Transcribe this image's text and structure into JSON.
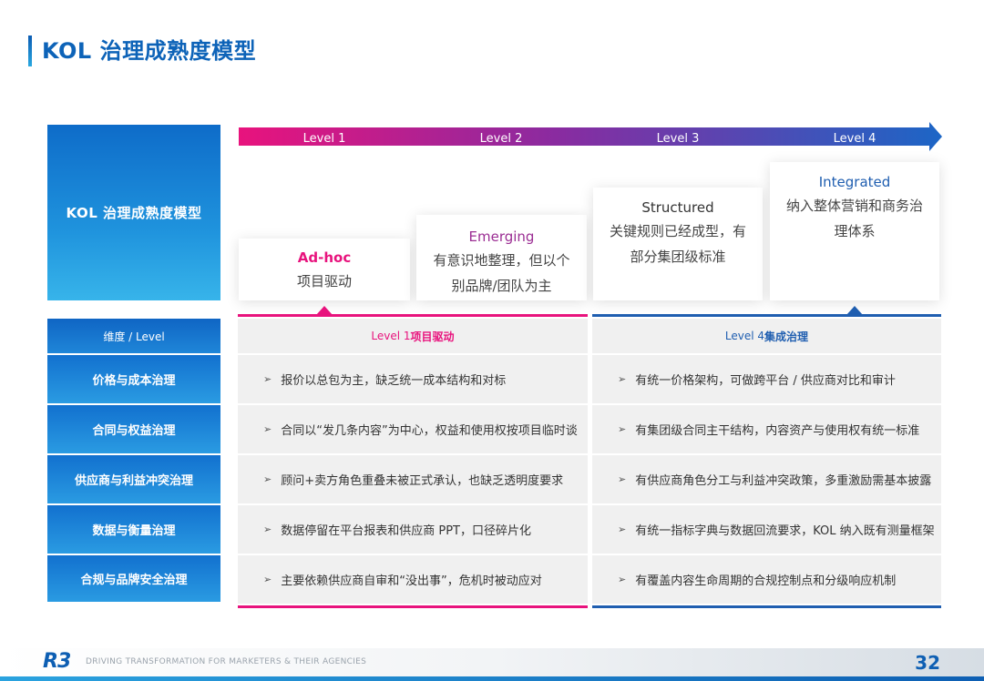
{
  "page": {
    "title": "KOL 治理成熟度模型",
    "page_number": "32",
    "footer_logo": "R3",
    "footer_tagline": "DRIVING TRANSFORMATION FOR MARKETERS & THEIR AGENCIES"
  },
  "model_label": "KOL 治理成熟度模型",
  "levels": [
    "Level 1",
    "Level 2",
    "Level 3",
    "Level 4"
  ],
  "cards": [
    {
      "name": "Ad-hoc",
      "desc": [
        "项目驱动"
      ]
    },
    {
      "name": "Emerging",
      "desc": [
        "有意识地整理，但以个",
        "别品牌/团队为主"
      ]
    },
    {
      "name": "Structured",
      "desc": [
        "关键规则已经成型，有",
        "部分集团级标准"
      ]
    },
    {
      "name": "Integrated",
      "desc": [
        "纳入整体营销和商务治",
        "理体系"
      ]
    }
  ],
  "table": {
    "dimension_header": "维度 / Level",
    "col1_header_prefix": "Level 1 ",
    "col1_header_bold": "项目驱动",
    "col2_header_prefix": "Level 4 ",
    "col2_header_bold": "集成治理",
    "bullet_symbol": "➢",
    "rows": [
      {
        "dimension": "价格与成本治理",
        "level1": "报价以总包为主，缺乏统一成本结构和对标",
        "level4": "有统一价格架构，可做跨平台 / 供应商对比和审计"
      },
      {
        "dimension": "合同与权益治理",
        "level1": "合同以“发几条内容”为中心，权益和使用权按项目临时谈",
        "level4": "有集团级合同主干结构，内容资产与使用权有统一标准"
      },
      {
        "dimension": "供应商与利益冲突治理",
        "level1": "顾问+卖方角色重叠未被正式承认，也缺乏透明度要求",
        "level4": "有供应商角色分工与利益冲突政策，多重激励需基本披露"
      },
      {
        "dimension": "数据与衡量治理",
        "level1": "数据停留在平台报表和供应商 PPT，口径碎片化",
        "level4": "有统一指标字典与数据回流要求，KOL 纳入既有测量框架"
      },
      {
        "dimension": "合规与品牌安全治理",
        "level1": "主要依赖供应商自审和“没出事”，危机时被动应对",
        "level4": "有覆盖内容生命周期的合规控制点和分级响应机制"
      }
    ]
  },
  "colors": {
    "accent_pink": "#e8137d",
    "accent_blue": "#1f5eb0",
    "brand_blue": "#0d63b8"
  }
}
